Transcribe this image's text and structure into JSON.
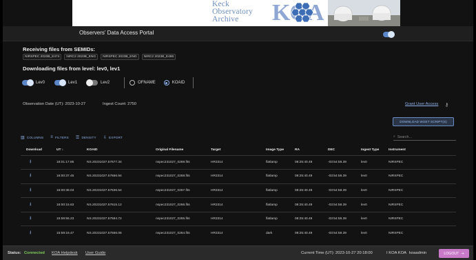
{
  "banner": {
    "logo_lines": [
      "Keck",
      "Observatory",
      "Archive"
    ],
    "logo_mark": "KOA"
  },
  "header": {
    "title": "Observers' Data Access Portal",
    "dark_mode_toggle": true
  },
  "receiving": {
    "title": "Receiving files from SEMIDs:",
    "semids": [
      "NIRSPEC 2023B_E474",
      "NIRC2 2023B_ENG",
      "NIRSPEC 2023B_ENG",
      "NIRC2 2023B_E486"
    ]
  },
  "downloading": {
    "title": "Downloading files from level: lev0, lev1",
    "levels": [
      {
        "label": "Lev0",
        "on": true
      },
      {
        "label": "Lev1",
        "on": true
      },
      {
        "label": "Lev2",
        "on": false
      }
    ],
    "name_options": [
      {
        "label": "OFNAME",
        "selected": false
      },
      {
        "label": "KOAID",
        "selected": true
      }
    ]
  },
  "info": {
    "obs_date": "Observation Date (UT): 2023-10-27",
    "ingest_count": "Ingest Count: 2750",
    "grant_link": "Grant User Access"
  },
  "download_script_label": "DOWNLOAD WGET SCRIPT(S)",
  "grid_toolbar": {
    "columns": "COLUMNS",
    "filters": "FILTERS",
    "density": "DENSITY",
    "export": "EXPORT",
    "search_placeholder": "Search…"
  },
  "table": {
    "headers": {
      "download": "Download",
      "ut": "UT",
      "koaid": "KOAID",
      "filename": "Original Filename",
      "target": "Target",
      "imtype": "Image Type",
      "ra": "RA",
      "dec": "DEC",
      "ingest": "Ingest Type",
      "instrument": "Instrument"
    },
    "rows": [
      {
        "ut": "16:01:17.85",
        "koaid": "NS.20231027.57677.34",
        "filename": "nspec231027_0269.fits",
        "target": "HR3314",
        "imtype": "flatlamp",
        "ra": "08:25:40.49",
        "dec": "-03:54:58.39",
        "ingest": "lev0",
        "instrument": "NIRSPEC"
      },
      {
        "ut": "16:00:37.45",
        "koaid": "NS.20231027.57656.94",
        "filename": "nspec231027_0268.fits",
        "target": "HR3314",
        "imtype": "flatlamp",
        "ra": "08:25:40.49",
        "dec": "-03:54:58.39",
        "ingest": "lev0",
        "instrument": "NIRSPEC"
      },
      {
        "ut": "16:00:38.03",
        "koaid": "NS.20231027.57636.54",
        "filename": "nspec231027_0267.fits",
        "target": "HR3314",
        "imtype": "flatlamp",
        "ra": "08:25:40.49",
        "dec": "-03:54:58.39",
        "ingest": "lev0",
        "instrument": "NIRSPEC"
      },
      {
        "ut": "16:00:15.63",
        "koaid": "NS.20231027.57615.12",
        "filename": "nspec231027_0266.fits",
        "target": "HR3314",
        "imtype": "flatlamp",
        "ra": "08:25:40.49",
        "dec": "-03:54:58.39",
        "ingest": "lev0",
        "instrument": "NIRSPEC"
      },
      {
        "ut": "15:59:55.23",
        "koaid": "NS.20231027.57594.72",
        "filename": "nspec231027_0265.fits",
        "target": "HR3314",
        "imtype": "flatlamp",
        "ra": "08:25:40.49",
        "dec": "-03:54:58.39",
        "ingest": "lev0",
        "instrument": "NIRSPEC"
      },
      {
        "ut": "15:59:16.47",
        "koaid": "NS.20231027.57556.06",
        "filename": "nspec231027_0264.fits",
        "target": "HR3314",
        "imtype": "dark",
        "ra": "08:25:40.49",
        "dec": "-03:54:58.39",
        "ingest": "lev0",
        "instrument": "NIRSPEC"
      }
    ]
  },
  "status": {
    "label": "Status:",
    "value": "Connected",
    "value_color": "#7fce5a",
    "helpdesk": "KOA Helpdesk",
    "user_guide": "User Guide",
    "current_time": "Current Time (UT): 2023-10-27 20:18:00",
    "user": "I KOA KOA",
    "username": "koaadmin",
    "logout": "LOGOUT"
  }
}
